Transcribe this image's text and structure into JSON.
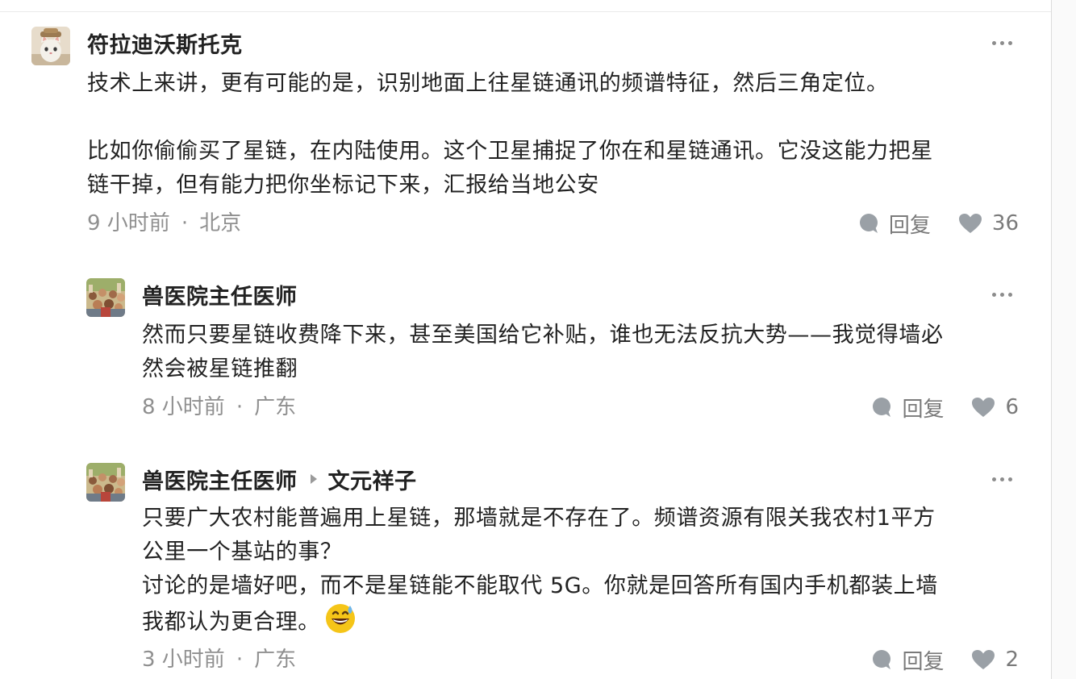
{
  "comments": [
    {
      "author": "符拉迪沃斯托克",
      "avatar": "cartoon-cat-avatar",
      "lines": [
        "技术上来讲，更有可能的是，识别地面上往星链通讯的频谱特征，然后三角定位。",
        "",
        "比如你偷偷买了星链，在内陆使用。这个卫星捕捉了你在和星链通讯。它没这能力把星",
        "链干掉，但有能力把你坐标记下来，汇报给当地公安"
      ],
      "time": "9 小时前",
      "location": "北京",
      "reply_label": "回复",
      "likes": "36"
    },
    {
      "author": "兽医院主任医师",
      "avatar": "crowd-photo-avatar",
      "lines": [
        "然而只要星链收费降下来，甚至美国给它补贴，谁也无法反抗大势——我觉得墙必",
        "然会被星链推翻"
      ],
      "time": "8 小时前",
      "location": "广东",
      "reply_label": "回复",
      "likes": "6"
    },
    {
      "author": "兽医院主任医师",
      "reply_to": "文元祥子",
      "avatar": "crowd-photo-avatar",
      "lines": [
        "只要广大农村能普遍用上星链，那墙就是不存在了。频谱资源有限关我农村1平方",
        "公里一个基站的事？",
        "讨论的是墙好吧，而不是星链能不能取代 5G。你就是回答所有国内手机都装上墙",
        "我都认为更合理。"
      ],
      "emoji": "grinning-sweat-emoji",
      "time": "3 小时前",
      "location": "广东",
      "reply_label": "回复",
      "likes": "2"
    }
  ],
  "colors": {
    "text": "#222222",
    "meta": "#8f8f8f",
    "icon": "#9aa0a6",
    "emoji_face": "#f5c518"
  }
}
